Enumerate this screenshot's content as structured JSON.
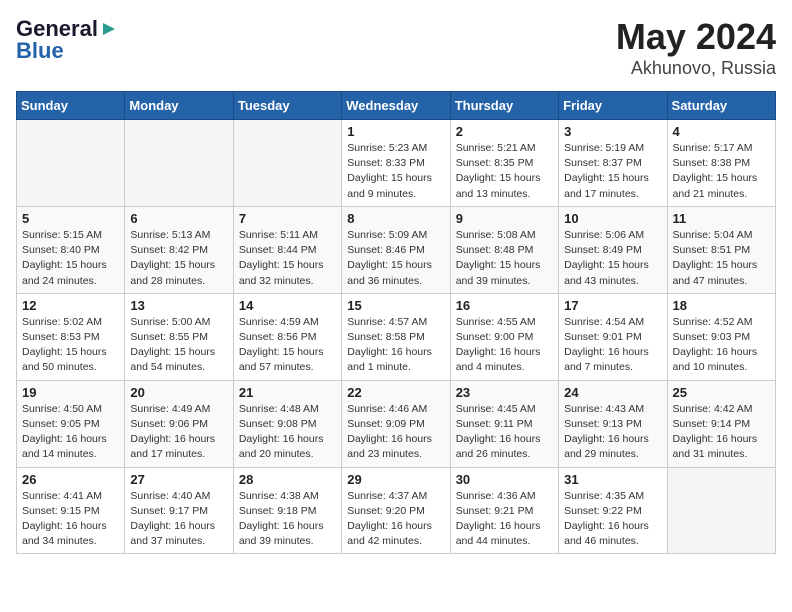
{
  "header": {
    "logo_general": "General",
    "logo_blue": "Blue",
    "title": "May 2024",
    "subtitle": "Akhunovo, Russia"
  },
  "calendar": {
    "days_of_week": [
      "Sunday",
      "Monday",
      "Tuesday",
      "Wednesday",
      "Thursday",
      "Friday",
      "Saturday"
    ],
    "weeks": [
      [
        {
          "day": "",
          "info": ""
        },
        {
          "day": "",
          "info": ""
        },
        {
          "day": "",
          "info": ""
        },
        {
          "day": "1",
          "info": "Sunrise: 5:23 AM\nSunset: 8:33 PM\nDaylight: 15 hours\nand 9 minutes."
        },
        {
          "day": "2",
          "info": "Sunrise: 5:21 AM\nSunset: 8:35 PM\nDaylight: 15 hours\nand 13 minutes."
        },
        {
          "day": "3",
          "info": "Sunrise: 5:19 AM\nSunset: 8:37 PM\nDaylight: 15 hours\nand 17 minutes."
        },
        {
          "day": "4",
          "info": "Sunrise: 5:17 AM\nSunset: 8:38 PM\nDaylight: 15 hours\nand 21 minutes."
        }
      ],
      [
        {
          "day": "5",
          "info": "Sunrise: 5:15 AM\nSunset: 8:40 PM\nDaylight: 15 hours\nand 24 minutes."
        },
        {
          "day": "6",
          "info": "Sunrise: 5:13 AM\nSunset: 8:42 PM\nDaylight: 15 hours\nand 28 minutes."
        },
        {
          "day": "7",
          "info": "Sunrise: 5:11 AM\nSunset: 8:44 PM\nDaylight: 15 hours\nand 32 minutes."
        },
        {
          "day": "8",
          "info": "Sunrise: 5:09 AM\nSunset: 8:46 PM\nDaylight: 15 hours\nand 36 minutes."
        },
        {
          "day": "9",
          "info": "Sunrise: 5:08 AM\nSunset: 8:48 PM\nDaylight: 15 hours\nand 39 minutes."
        },
        {
          "day": "10",
          "info": "Sunrise: 5:06 AM\nSunset: 8:49 PM\nDaylight: 15 hours\nand 43 minutes."
        },
        {
          "day": "11",
          "info": "Sunrise: 5:04 AM\nSunset: 8:51 PM\nDaylight: 15 hours\nand 47 minutes."
        }
      ],
      [
        {
          "day": "12",
          "info": "Sunrise: 5:02 AM\nSunset: 8:53 PM\nDaylight: 15 hours\nand 50 minutes."
        },
        {
          "day": "13",
          "info": "Sunrise: 5:00 AM\nSunset: 8:55 PM\nDaylight: 15 hours\nand 54 minutes."
        },
        {
          "day": "14",
          "info": "Sunrise: 4:59 AM\nSunset: 8:56 PM\nDaylight: 15 hours\nand 57 minutes."
        },
        {
          "day": "15",
          "info": "Sunrise: 4:57 AM\nSunset: 8:58 PM\nDaylight: 16 hours\nand 1 minute."
        },
        {
          "day": "16",
          "info": "Sunrise: 4:55 AM\nSunset: 9:00 PM\nDaylight: 16 hours\nand 4 minutes."
        },
        {
          "day": "17",
          "info": "Sunrise: 4:54 AM\nSunset: 9:01 PM\nDaylight: 16 hours\nand 7 minutes."
        },
        {
          "day": "18",
          "info": "Sunrise: 4:52 AM\nSunset: 9:03 PM\nDaylight: 16 hours\nand 10 minutes."
        }
      ],
      [
        {
          "day": "19",
          "info": "Sunrise: 4:50 AM\nSunset: 9:05 PM\nDaylight: 16 hours\nand 14 minutes."
        },
        {
          "day": "20",
          "info": "Sunrise: 4:49 AM\nSunset: 9:06 PM\nDaylight: 16 hours\nand 17 minutes."
        },
        {
          "day": "21",
          "info": "Sunrise: 4:48 AM\nSunset: 9:08 PM\nDaylight: 16 hours\nand 20 minutes."
        },
        {
          "day": "22",
          "info": "Sunrise: 4:46 AM\nSunset: 9:09 PM\nDaylight: 16 hours\nand 23 minutes."
        },
        {
          "day": "23",
          "info": "Sunrise: 4:45 AM\nSunset: 9:11 PM\nDaylight: 16 hours\nand 26 minutes."
        },
        {
          "day": "24",
          "info": "Sunrise: 4:43 AM\nSunset: 9:13 PM\nDaylight: 16 hours\nand 29 minutes."
        },
        {
          "day": "25",
          "info": "Sunrise: 4:42 AM\nSunset: 9:14 PM\nDaylight: 16 hours\nand 31 minutes."
        }
      ],
      [
        {
          "day": "26",
          "info": "Sunrise: 4:41 AM\nSunset: 9:15 PM\nDaylight: 16 hours\nand 34 minutes."
        },
        {
          "day": "27",
          "info": "Sunrise: 4:40 AM\nSunset: 9:17 PM\nDaylight: 16 hours\nand 37 minutes."
        },
        {
          "day": "28",
          "info": "Sunrise: 4:38 AM\nSunset: 9:18 PM\nDaylight: 16 hours\nand 39 minutes."
        },
        {
          "day": "29",
          "info": "Sunrise: 4:37 AM\nSunset: 9:20 PM\nDaylight: 16 hours\nand 42 minutes."
        },
        {
          "day": "30",
          "info": "Sunrise: 4:36 AM\nSunset: 9:21 PM\nDaylight: 16 hours\nand 44 minutes."
        },
        {
          "day": "31",
          "info": "Sunrise: 4:35 AM\nSunset: 9:22 PM\nDaylight: 16 hours\nand 46 minutes."
        },
        {
          "day": "",
          "info": ""
        }
      ]
    ]
  }
}
